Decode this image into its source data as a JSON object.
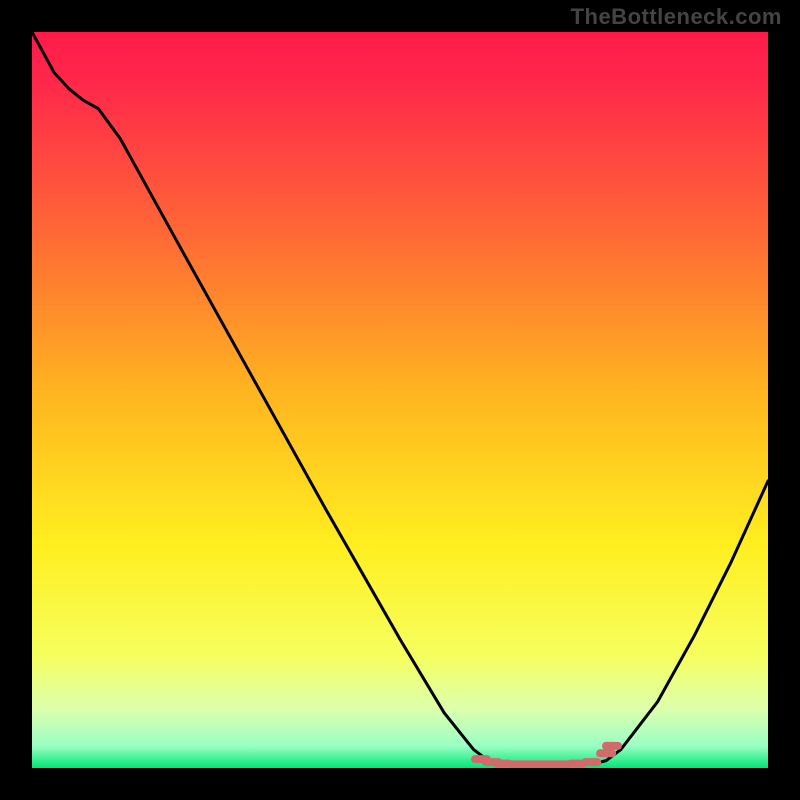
{
  "watermark": "TheBottleneck.com",
  "chart_data": {
    "type": "line",
    "title": "",
    "xlabel": "",
    "ylabel": "",
    "xlim": [
      0,
      100
    ],
    "ylim": [
      0,
      100
    ],
    "background_gradient_stops": [
      {
        "offset": 0.0,
        "color": "#ff1a4a"
      },
      {
        "offset": 0.08,
        "color": "#ff2b49"
      },
      {
        "offset": 0.28,
        "color": "#ff6a35"
      },
      {
        "offset": 0.5,
        "color": "#ffb81f"
      },
      {
        "offset": 0.7,
        "color": "#ffef20"
      },
      {
        "offset": 0.85,
        "color": "#f6ff60"
      },
      {
        "offset": 0.92,
        "color": "#dcffad"
      },
      {
        "offset": 0.97,
        "color": "#9affc4"
      },
      {
        "offset": 1.0,
        "color": "#00e676"
      }
    ],
    "curve_points": [
      {
        "x": 0.0,
        "y": 100.0
      },
      {
        "x": 3.0,
        "y": 94.5
      },
      {
        "x": 5.0,
        "y": 92.3
      },
      {
        "x": 7.0,
        "y": 90.7
      },
      {
        "x": 9.0,
        "y": 89.6
      },
      {
        "x": 12.0,
        "y": 85.5
      },
      {
        "x": 20.0,
        "y": 71.0
      },
      {
        "x": 30.0,
        "y": 53.0
      },
      {
        "x": 40.0,
        "y": 35.0
      },
      {
        "x": 50.0,
        "y": 17.5
      },
      {
        "x": 56.0,
        "y": 7.5
      },
      {
        "x": 60.0,
        "y": 2.5
      },
      {
        "x": 62.0,
        "y": 1.0
      },
      {
        "x": 64.0,
        "y": 0.5
      },
      {
        "x": 70.0,
        "y": 0.5
      },
      {
        "x": 76.0,
        "y": 0.5
      },
      {
        "x": 78.0,
        "y": 1.0
      },
      {
        "x": 80.0,
        "y": 2.5
      },
      {
        "x": 85.0,
        "y": 9.0
      },
      {
        "x": 90.0,
        "y": 18.0
      },
      {
        "x": 95.0,
        "y": 28.0
      },
      {
        "x": 100.0,
        "y": 39.0
      }
    ],
    "marker_dashes": [
      {
        "x": 61.0,
        "y": 1.2
      },
      {
        "x": 62.5,
        "y": 0.8
      },
      {
        "x": 64.0,
        "y": 0.6
      },
      {
        "x": 66.0,
        "y": 0.5
      },
      {
        "x": 68.0,
        "y": 0.5
      },
      {
        "x": 70.0,
        "y": 0.5
      },
      {
        "x": 72.0,
        "y": 0.5
      },
      {
        "x": 74.0,
        "y": 0.6
      },
      {
        "x": 76.0,
        "y": 0.8
      },
      {
        "x": 78.0,
        "y": 2.0
      },
      {
        "x": 78.8,
        "y": 3.0
      }
    ]
  }
}
